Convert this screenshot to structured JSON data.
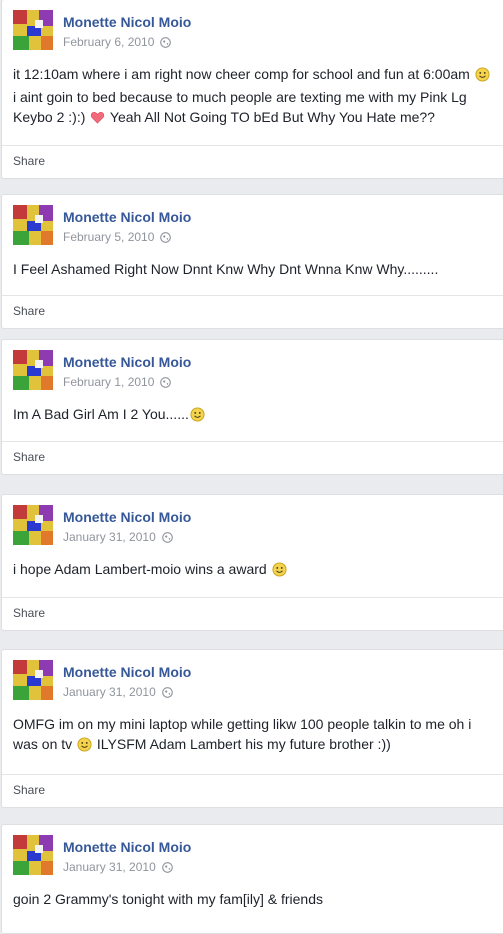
{
  "posts": [
    {
      "author": "Monette Nicol Moio",
      "date": "February 6, 2010",
      "text_parts": [
        "it 12:10am where i am right now cheer comp for school and fun at 6:00am ",
        " i aint goin to bed because to much people are texting me with my Pink Lg Keybo 2 :):) ",
        " Yeah All Not Going TO bEd But Why You Hate me??"
      ],
      "share_label": "Share"
    },
    {
      "author": "Monette Nicol Moio",
      "date": "February 5, 2010",
      "text": "I Feel Ashamed Right Now Dnnt Knw Why Dnt Wnna Knw Why.........",
      "share_label": "Share"
    },
    {
      "author": "Monette Nicol Moio",
      "date": "February 1, 2010",
      "text": "Im A Bad Girl Am I 2 You......",
      "share_label": "Share"
    },
    {
      "author": "Monette Nicol Moio",
      "date": "January 31, 2010",
      "text": "i hope Adam Lambert-moio wins a award ",
      "share_label": "Share"
    },
    {
      "author": "Monette Nicol Moio",
      "date": "January 31, 2010",
      "text_parts": [
        "OMFG im on my mini laptop while getting likw 100 people talkin to me oh i was on tv ",
        " ILYSFM Adam Lambert his my future brother :))"
      ],
      "share_label": "Share"
    },
    {
      "author": "Monette Nicol Moio",
      "date": "January 31, 2010",
      "text": "goin 2 Grammy's tonight with my fam[ily] & friends"
    }
  ],
  "icons": {
    "privacy": "globe-icon",
    "smile": "smile-emoji-icon",
    "heart": "heart-emoji-icon"
  },
  "colors": {
    "author_link": "#365899",
    "meta_gray": "#90949c",
    "page_bg": "#e9ebee"
  }
}
